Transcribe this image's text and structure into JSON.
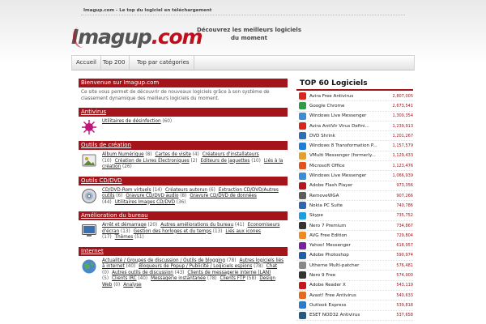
{
  "header": {
    "top_line": "Imagup.com - Le top du logiciel en téléchargement",
    "logo_dark": "Imagup",
    "logo_red": ".com",
    "slogan": "Découvrez les meilleurs logiciels du moment"
  },
  "nav": [
    {
      "label": "Accueil"
    },
    {
      "label": "Top 200"
    },
    {
      "label": "Top par catégories"
    }
  ],
  "welcome": {
    "title": "Bienvenue sur Imagup.com",
    "text": "Ce site vous permet de découvrir de nouveaux logiciels grâce à son système de classement dynamique des meilleurs logiciels du moment."
  },
  "sections": [
    {
      "title": "Antivirus",
      "icon": "virus-icon",
      "icon_color": "#c0157a",
      "links": [
        {
          "label": "Utilitaires de désinfection",
          "count": "(60)"
        }
      ]
    },
    {
      "title": "Outils de création",
      "icon": "photo-icon",
      "icon_color": "#777777",
      "links": [
        {
          "label": "Album Numérique",
          "count": "(8)"
        },
        {
          "label": "Cartes de visite",
          "count": "(4)"
        },
        {
          "label": "Créateurs d'installateurs",
          "count": "(10)"
        },
        {
          "label": "Création de Livres Électroniques",
          "count": "(2)"
        },
        {
          "label": "Editeurs de jaquettes",
          "count": "(10)"
        },
        {
          "label": "Liés à la création",
          "count": "(26)"
        }
      ]
    },
    {
      "title": "Outils CD/DVD",
      "icon": "cd-icon",
      "icon_color": "#666666",
      "links": [
        {
          "label": "CD/DVD-Rom virtuels",
          "count": "(14)"
        },
        {
          "label": "Créateurs autorun",
          "count": "(6)"
        },
        {
          "label": "Extraction CD/DVD/Autres outils",
          "count": "(6)"
        },
        {
          "label": "Gravure CD/DVD audio",
          "count": "(8)"
        },
        {
          "label": "Gravure CD/DVD de données",
          "count": "(44)"
        },
        {
          "label": "Utilitaires Images CD/DVD",
          "count": "(36)"
        }
      ]
    },
    {
      "title": "Amélioration du bureau",
      "icon": "monitor-icon",
      "icon_color": "#3a6fb0",
      "links": [
        {
          "label": "Arrêt et démarrage",
          "count": "(20)"
        },
        {
          "label": "Autres améliorations du bureau",
          "count": "(41)"
        },
        {
          "label": "Economiseurs d'écran",
          "count": "(13)"
        },
        {
          "label": "Gestion des horloges et du temps",
          "count": "(13)"
        },
        {
          "label": "Liés aux icones",
          "count": "(17)"
        },
        {
          "label": "Thèmes",
          "count": "(51)"
        }
      ]
    },
    {
      "title": "Internet",
      "icon": "globe-icon",
      "icon_color": "#4a88c8",
      "links": [
        {
          "label": "Actualité / Groupes de discussion / Outils de blogging",
          "count": "(78)"
        },
        {
          "label": "Autres logiciels liés à internet",
          "count": "(40)"
        },
        {
          "label": "Bloqueurs de Popup / Publicité / Logiciels espions",
          "count": "(78)"
        },
        {
          "label": "Chat",
          "count": "(0)"
        },
        {
          "label": "Autres outils de discussion",
          "count": "(43)"
        },
        {
          "label": "Clients de messagerie interne (LAN)",
          "count": "(5)"
        },
        {
          "label": "Clients IRC",
          "count": "(40)"
        },
        {
          "label": "Messagerie instantanée",
          "count": "(78)"
        },
        {
          "label": "Clients FTP",
          "count": "(58)"
        },
        {
          "label": "Design Web",
          "count": "(0)"
        },
        {
          "label": "Analyse",
          "count": ""
        }
      ]
    }
  ],
  "top": {
    "title": "TOP 60 Logiciels",
    "items": [
      {
        "name": "Avira Free Antivirus",
        "count": "2,807,005",
        "icon": "avira-icon",
        "color": "#d9261c"
      },
      {
        "name": "Google Chrome",
        "count": "2,673,541",
        "icon": "chrome-icon",
        "color": "#2f9a48"
      },
      {
        "name": "Windows Live Messenger",
        "count": "1,300,354",
        "icon": "messenger-icon",
        "color": "#3b8ed6"
      },
      {
        "name": "Avira AntiVir Virus Defini...",
        "count": "1,239,913",
        "icon": "avira-icon",
        "color": "#d9261c"
      },
      {
        "name": "DVD Shrink",
        "count": "1,201,267",
        "icon": "dvd-icon",
        "color": "#2d6db5"
      },
      {
        "name": "Windows 8 Transformation P...",
        "count": "1,157,579",
        "icon": "windows-icon",
        "color": "#1f7fd6"
      },
      {
        "name": "VMulti Messenger (formerly...",
        "count": "1,129,433",
        "icon": "messenger-icon",
        "color": "#e3a12b"
      },
      {
        "name": "Microsoft Office",
        "count": "1,123,476",
        "icon": "office-icon",
        "color": "#e2531d"
      },
      {
        "name": "Windows Live Messenger",
        "count": "1,066,939",
        "icon": "messenger-icon",
        "color": "#3b8ed6"
      },
      {
        "name": "Adobe Flash Player",
        "count": "973,356",
        "icon": "flash-icon",
        "color": "#b8141b"
      },
      {
        "name": "RemoveWGA",
        "count": "907,266",
        "icon": "tool-icon",
        "color": "#5c5c5c"
      },
      {
        "name": "Nokia PC Suite",
        "count": "740,786",
        "icon": "phone-icon",
        "color": "#3066b0"
      },
      {
        "name": "Skype",
        "count": "735,752",
        "icon": "skype-icon",
        "color": "#1c9fe0"
      },
      {
        "name": "Nero 7 Premium",
        "count": "734,867",
        "icon": "nero-icon",
        "color": "#333333"
      },
      {
        "name": "AVG Free Edition",
        "count": "729,804",
        "icon": "avg-icon",
        "color": "#f08a1f"
      },
      {
        "name": "Yahoo! Messenger",
        "count": "618,957",
        "icon": "yahoo-icon",
        "color": "#7b1fa2"
      },
      {
        "name": "Adobe Photoshop",
        "count": "590,974",
        "icon": "photoshop-icon",
        "color": "#1f5fa8"
      },
      {
        "name": "Utherne Multi-patcher",
        "count": "576,481",
        "icon": "patch-icon",
        "color": "#888888"
      },
      {
        "name": "Nero 9 Free",
        "count": "574,900",
        "icon": "nero-icon",
        "color": "#333333"
      },
      {
        "name": "Adobe Reader X",
        "count": "543,119",
        "icon": "reader-icon",
        "color": "#c4161c"
      },
      {
        "name": "Avast! Free Antivirus",
        "count": "540,633",
        "icon": "avast-icon",
        "color": "#e46a1e"
      },
      {
        "name": "Outlook Express",
        "count": "539,818",
        "icon": "mail-icon",
        "color": "#2a7bc8"
      },
      {
        "name": "ESET NOD32 Antivirus",
        "count": "537,658",
        "icon": "eset-icon",
        "color": "#1f5c8a"
      }
    ]
  }
}
